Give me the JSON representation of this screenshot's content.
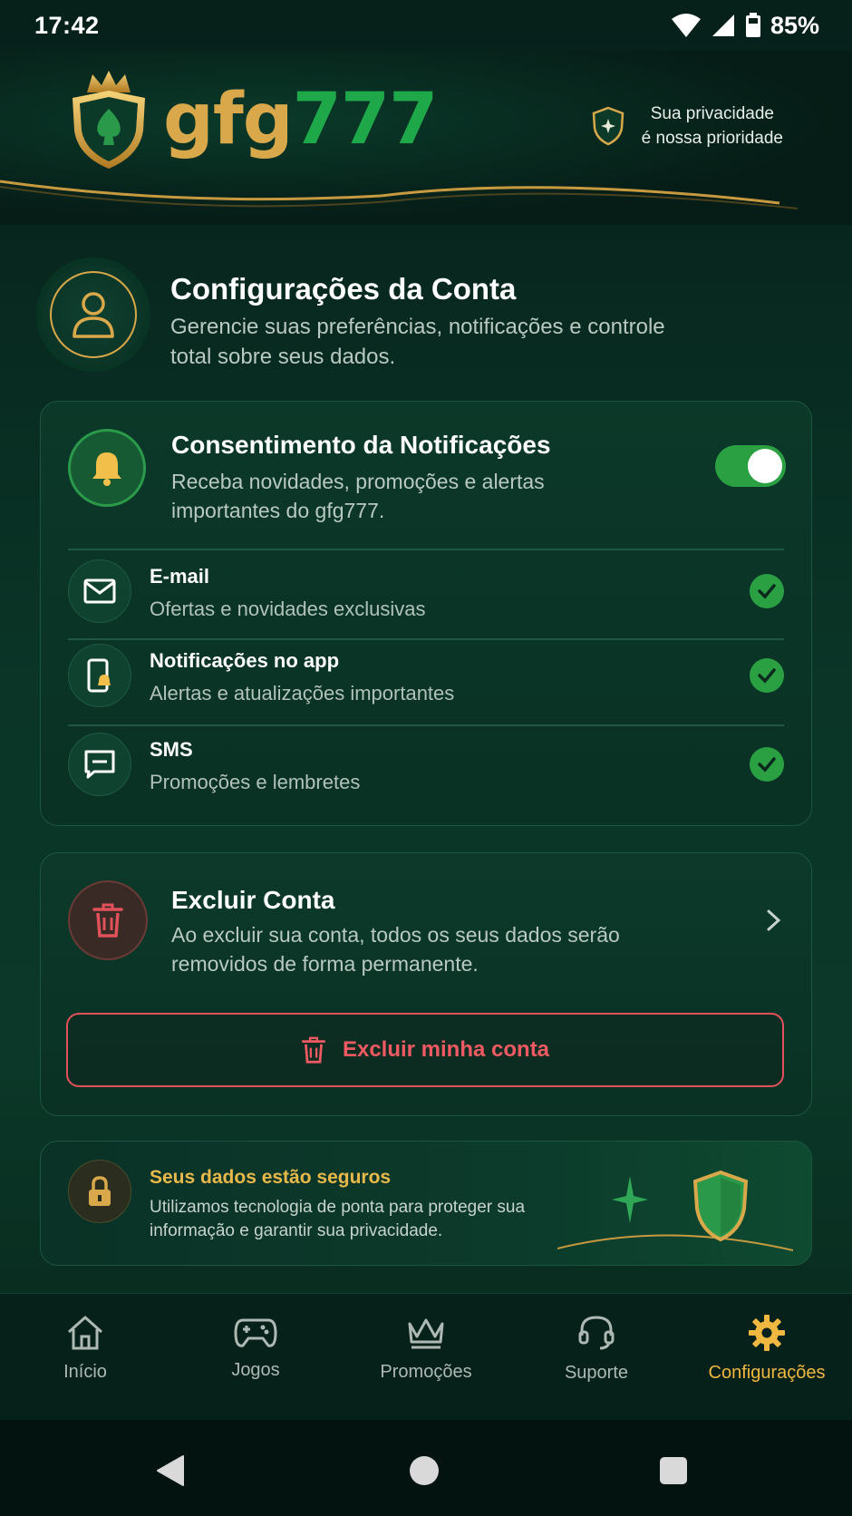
{
  "status_bar": {
    "time": "17:42",
    "battery": "85%"
  },
  "header": {
    "logo_part1": "gfg",
    "logo_part2": "777",
    "privacy_line1": "Sua privacidade",
    "privacy_line2": "é nossa prioridade"
  },
  "account": {
    "title": "Configurações da Conta",
    "subtitle": "Gerencie suas preferências, notificações e controle total sobre seus dados."
  },
  "notifications": {
    "title": "Consentimento da Notificações",
    "subtitle": "Receba novidades, promoções e alertas importantes do gfg777.",
    "enabled": true,
    "channels": [
      {
        "title": "E-mail",
        "subtitle": "Ofertas e novidades exclusivas",
        "checked": true,
        "icon": "mail-icon"
      },
      {
        "title": "Notificações no app",
        "subtitle": "Alertas e atualizações importantes",
        "checked": true,
        "icon": "phone-notification-icon"
      },
      {
        "title": "SMS",
        "subtitle": "Promoções e lembretes",
        "checked": true,
        "icon": "message-icon"
      }
    ]
  },
  "delete_account": {
    "title": "Excluir Conta",
    "subtitle": "Ao excluir sua conta, todos os seus dados serão removidos de forma permanente.",
    "button_label": "Excluir minha conta"
  },
  "security": {
    "title": "Seus dados estão seguros",
    "subtitle": "Utilizamos tecnologia de ponta para proteger sua informação e garantir sua privacidade."
  },
  "bottom_nav": {
    "items": [
      {
        "label": "Início",
        "icon": "home-icon",
        "active": false
      },
      {
        "label": "Jogos",
        "icon": "gamepad-icon",
        "active": false
      },
      {
        "label": "Promoções",
        "icon": "crown-icon",
        "active": false
      },
      {
        "label": "Suporte",
        "icon": "headset-icon",
        "active": false
      },
      {
        "label": "Configurações",
        "icon": "gear-icon",
        "active": true
      }
    ]
  },
  "colors": {
    "accent_gold": "#f0b840",
    "accent_green": "#2aa043",
    "danger": "#ef5a62",
    "background": "#0a3527"
  }
}
